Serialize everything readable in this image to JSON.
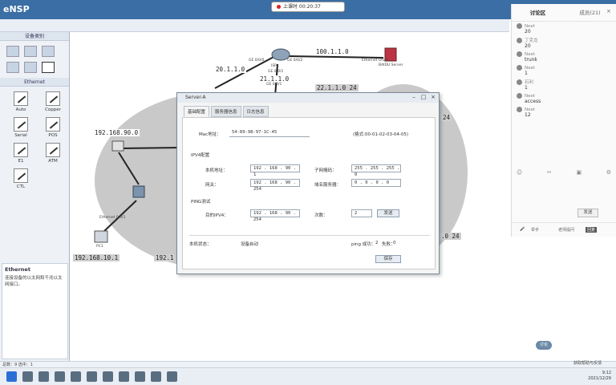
{
  "app": {
    "title": "eNSP"
  },
  "recording": {
    "label": "上课时 00:20:37"
  },
  "left_panel": {
    "devices_title": "设备类别",
    "connections_title": "Ethernet",
    "connections": [
      {
        "label": "Auto",
        "icon": "auto-connection-icon"
      },
      {
        "label": "Copper",
        "icon": "copper-cable-icon"
      },
      {
        "label": "Serial",
        "icon": "serial-cable-icon"
      },
      {
        "label": "POS",
        "icon": "pos-cable-icon"
      },
      {
        "label": "E1",
        "icon": "e1-cable-icon"
      },
      {
        "label": "ATM",
        "icon": "atm-cable-icon"
      },
      {
        "label": "CTL",
        "icon": "ctl-cable-icon"
      }
    ],
    "desc_title": "Ethernet",
    "desc_text": "连接设备的以太网和千兆以太网接口。"
  },
  "topology": {
    "labels": {
      "net_left": "192.168.90.0",
      "net_top_left": "20.1.1.0",
      "net_isp_bottom": "21.1.1.0",
      "net_top_right": "100.1.1.0",
      "net_mid_right": "22.1.1.0 24",
      "net_right_edge": "24",
      "net_right_bottom": ".0 24",
      "net_pc1": "192.168.10.1",
      "net_pc_partial": "192.1"
    },
    "nodes": {
      "isp": "ISP",
      "server": "BAIDU Server",
      "pc1": "PC1"
    },
    "interfaces": {
      "isp_ge0": "GE 0/0/0",
      "isp_ge1": "GE 0/0/1",
      "isp_ge2": "GE 0/0/2",
      "isp_ge3": "GE 0/0/1",
      "server_eth": "Ethernet 0/0/0",
      "pc1_eth": "Ethernet 0/0/1"
    }
  },
  "dialog": {
    "title": "Server-A",
    "tabs": [
      "基础配置",
      "服务器信息",
      "日志信息"
    ],
    "mac_label": "Mac地址：",
    "mac_value": "54-89-98-97-1C-45",
    "mac_hint": "(格式:00-01-02-03-04-05)",
    "ipv4_title": "IPV4配置",
    "ip_label": "本机地址：",
    "ip_value": "192 . 168 . 90 . 1",
    "mask_label": "子网掩码：",
    "mask_value": "255 . 255 . 255 . 0",
    "gw_label": "网关：",
    "gw_value": "192 . 168 . 90 . 254",
    "dns_label": "域名服务器：",
    "dns_value": "0 . 0 . 0 . 0",
    "ping_title": "PING测试",
    "ping_dest_label": "目的IPV4：",
    "ping_dest_value": "192 . 168 . 90 . 254",
    "ping_count_label": "次数：",
    "ping_count_value": "2",
    "ping_button": "发送",
    "status_label": "本机状态：",
    "status_value": "设备启动",
    "ping_success_label": "ping 成功：",
    "ping_success_value": "2",
    "ping_fail_label": "失败：",
    "ping_fail_value": "0",
    "save_button": "保存"
  },
  "chat": {
    "tab_active": "讨论区",
    "tab_other": "成员(21)",
    "messages": [
      {
        "user": "Neet",
        "text": "20"
      },
      {
        "user": "丁克龙",
        "text": "20"
      },
      {
        "user": "Neet",
        "text": "trunk"
      },
      {
        "user": "Neet",
        "text": "1"
      },
      {
        "user": "石利",
        "text": "1"
      },
      {
        "user": "Neet",
        "text": "access"
      },
      {
        "user": "Neet",
        "text": "12"
      }
    ],
    "send_label": "发送",
    "bottom_items": [
      "举手",
      "老师提问",
      "回复"
    ]
  },
  "statusbar": {
    "text": "总数：9 选中：1"
  },
  "taskbar": {
    "time": "9:12",
    "date": "2021/12/29",
    "right_label": "获取帮助与反馈"
  },
  "chat_bubble": "讨论"
}
